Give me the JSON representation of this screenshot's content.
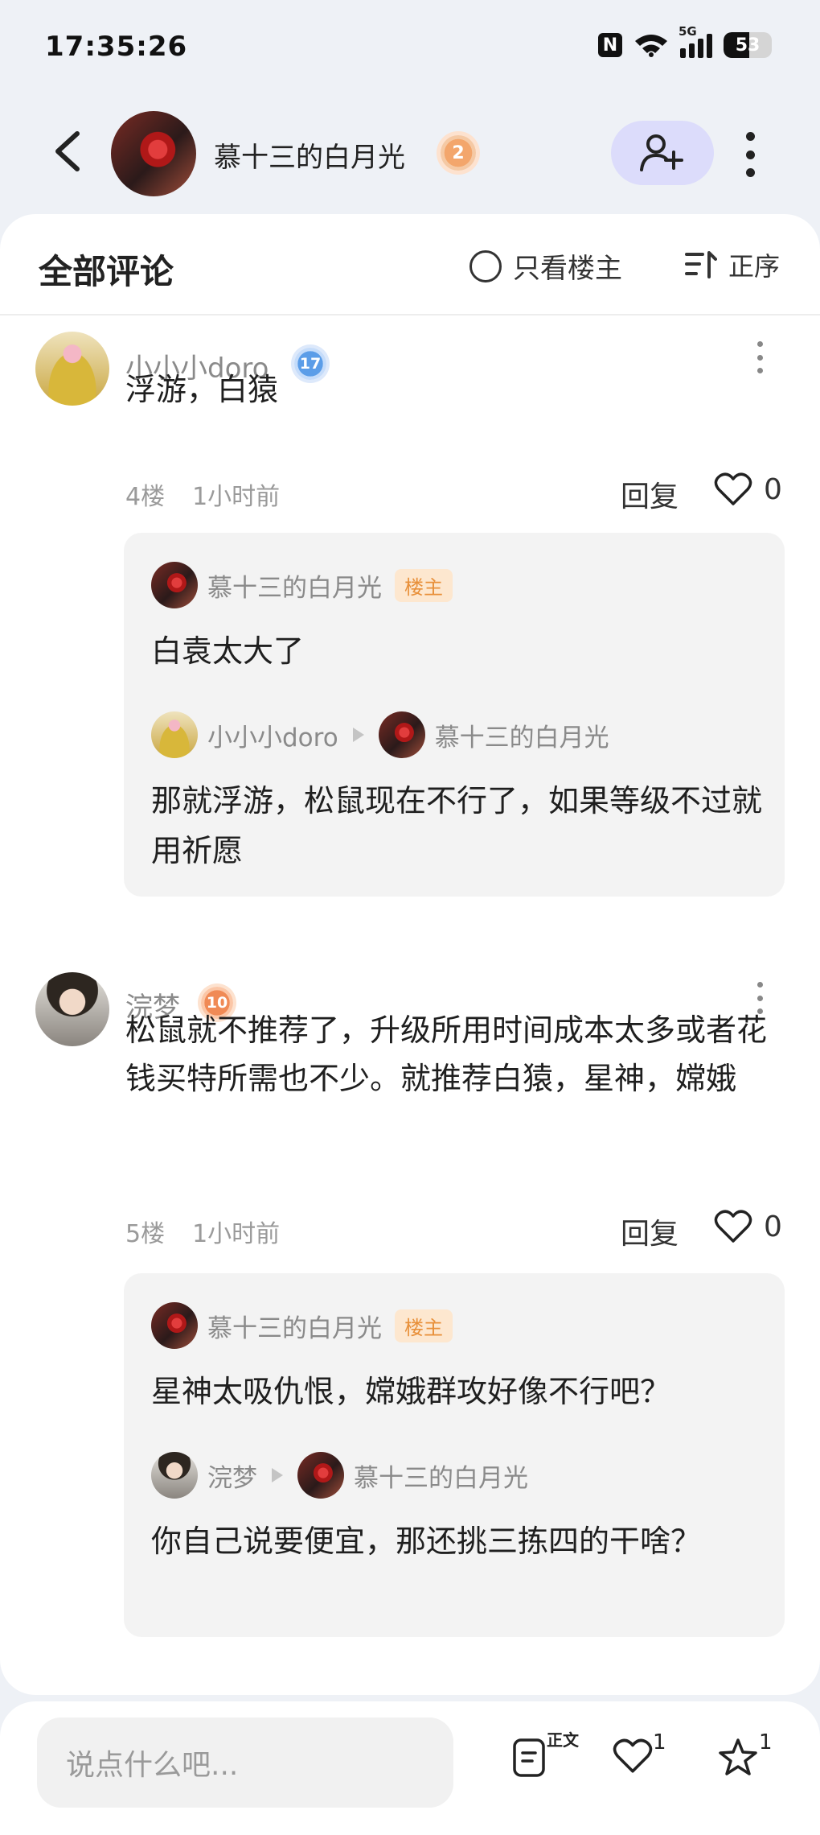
{
  "status_bar": {
    "time": "17:35:26",
    "network": "5G",
    "battery": "53"
  },
  "header": {
    "user_name": "慕十三的白月光",
    "user_level": "2"
  },
  "comments_header": {
    "title": "全部评论",
    "only_op_label": "只看楼主",
    "sort_label": "正序"
  },
  "comments": [
    {
      "user_name": "小小小doro",
      "user_level": "17",
      "text": "浮游，白猿",
      "floor": "4楼",
      "time": "1小时前",
      "reply_label": "回复",
      "likes": "0",
      "replies": [
        {
          "from": "慕十三的白月光",
          "op_badge": "楼主",
          "text": "白袁太大了"
        },
        {
          "from": "小小小doro",
          "to": "慕十三的白月光",
          "text": "那就浮游，松鼠现在不行了，如果等级不过就用祈愿"
        }
      ]
    },
    {
      "user_name": "浣梦",
      "user_level": "10",
      "text": "松鼠就不推荐了，升级所用时间成本太多或者花钱买特所需也不少。就推荐白猿，星神，嫦娥",
      "floor": "5楼",
      "time": "1小时前",
      "reply_label": "回复",
      "likes": "0",
      "replies": [
        {
          "from": "慕十三的白月光",
          "op_badge": "楼主",
          "text": "星神太吸仇恨，嫦娥群攻好像不行吧？"
        },
        {
          "from": "浣梦",
          "to": "慕十三的白月光",
          "text": "你自己说要便宜，那还挑三拣四的干啥？"
        }
      ]
    }
  ],
  "bottom_bar": {
    "input_placeholder": "说点什么吧...",
    "doc_badge": "正文",
    "like_count": "1",
    "fav_count": "1"
  }
}
